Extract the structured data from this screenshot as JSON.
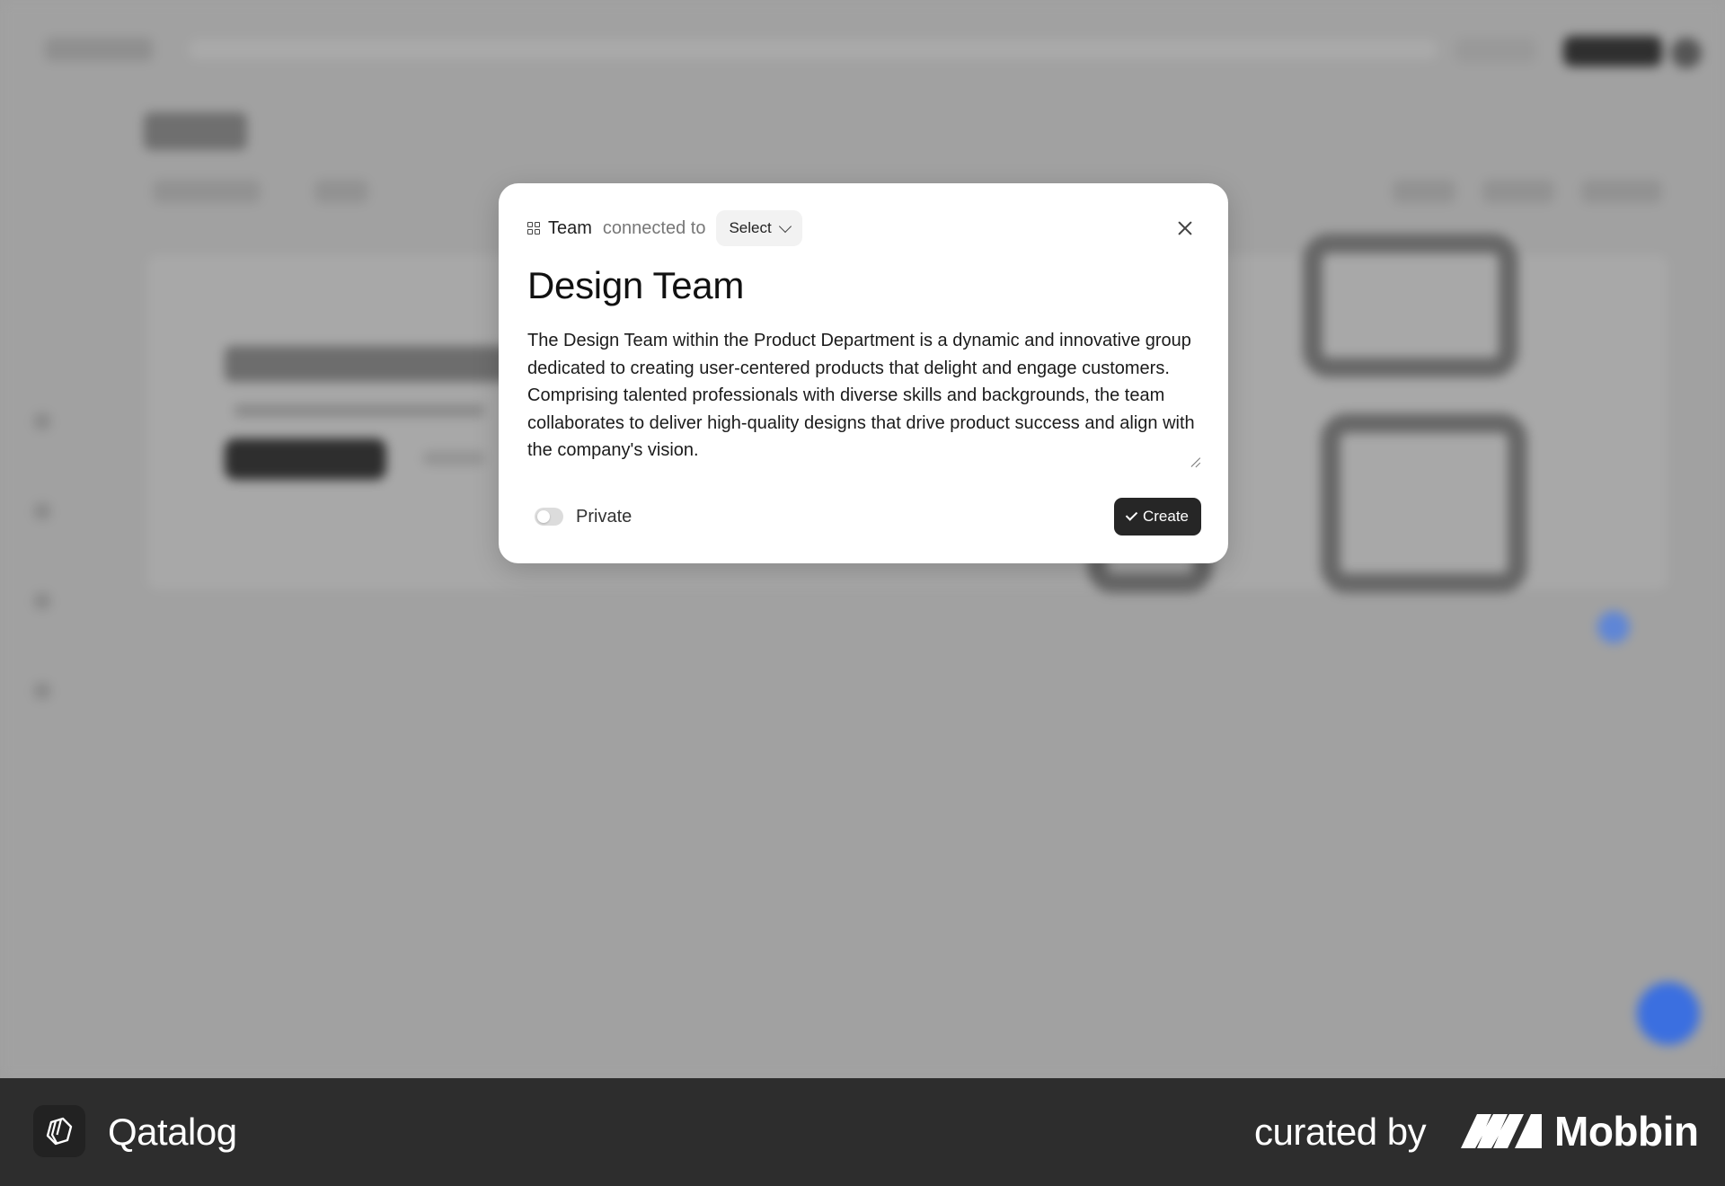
{
  "modal": {
    "type_label": "Team",
    "connected_label": "connected to",
    "select_label": "Select",
    "title": "Design Team",
    "description": "The Design Team within the Product Department is a dynamic and innovative group dedicated to creating user-centered products that delight and engage customers. Comprising talented professionals with diverse skills and backgrounds, the team collaborates to deliver high-quality designs that drive product success and align with the company's vision.",
    "private_label": "Private",
    "private_enabled": false,
    "create_label": "Create"
  },
  "icons": {
    "type": "grid-icon",
    "select": "chevron-down-icon",
    "close": "close-icon",
    "create": "check-icon"
  },
  "banner": {
    "app_name": "Qatalog",
    "curated_label": "curated by",
    "brand_name": "Mobbin"
  },
  "colors": {
    "overlay": "#9f9f9f",
    "primary_button": "#262626",
    "banner": "#2d2d2d",
    "accent_blue": "#3b6fe0"
  }
}
